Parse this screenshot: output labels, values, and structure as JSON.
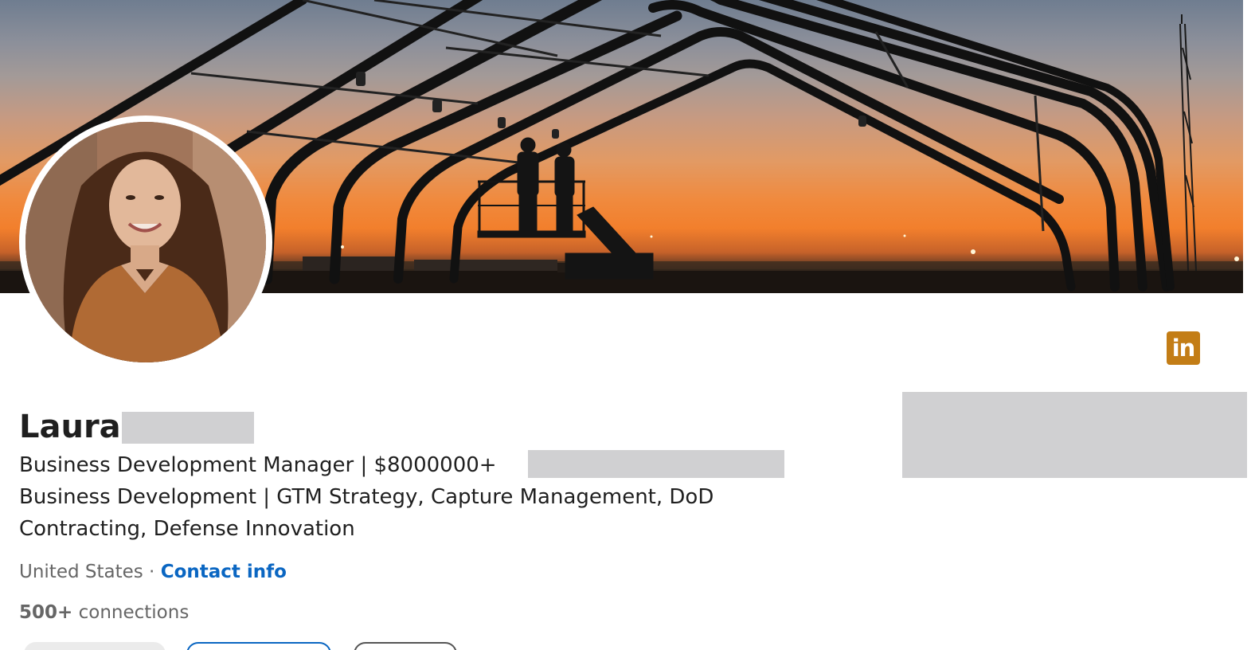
{
  "profile": {
    "first_name": "Laura",
    "headline_line1": "Business Development Manager | $8000000+",
    "headline_sep": "|",
    "headline_line2": "Business Development | GTM Strategy, Capture Management, DoD",
    "headline_line3": "Contracting, Defense Innovation",
    "location": "United States",
    "location_sep": " · ",
    "contact_info_label": "Contact info",
    "connections_count": "500+",
    "connections_label": " connections"
  },
  "badge": {
    "label": "in",
    "color": "#c37d16"
  },
  "colors": {
    "link": "#0a66c2",
    "text_primary": "#1f1f1f",
    "text_secondary": "#666666",
    "redaction": "#d0d0d2"
  }
}
